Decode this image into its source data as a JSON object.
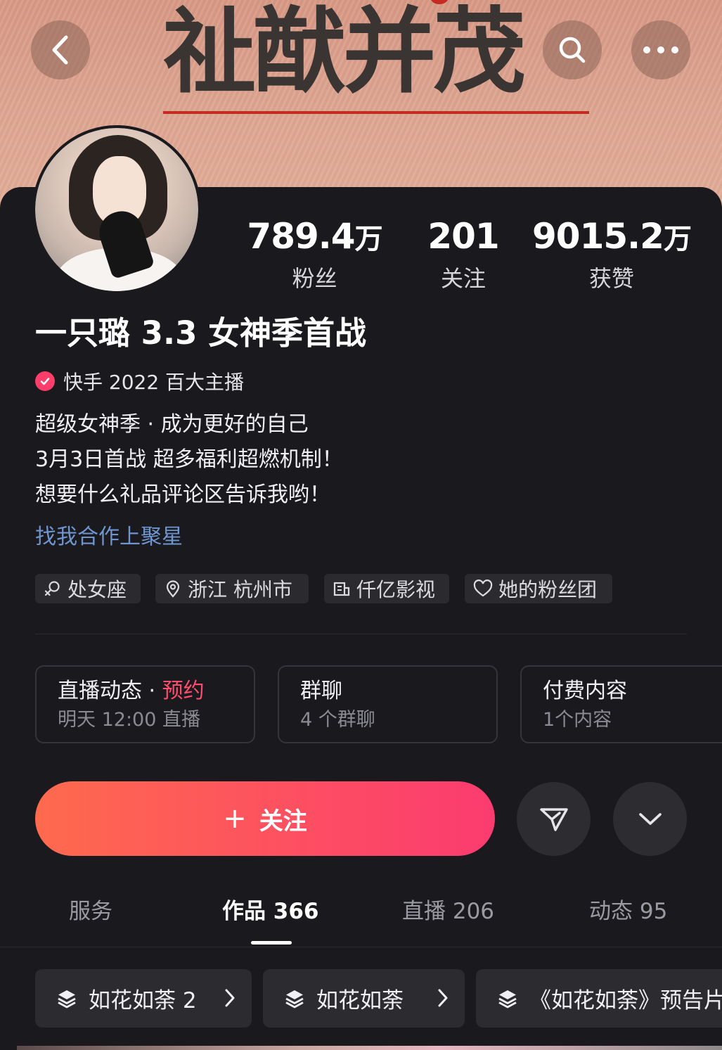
{
  "banner": {
    "title": "祉猷并茂"
  },
  "header": {
    "back": "back",
    "search": "search",
    "more": "more"
  },
  "stats": [
    {
      "value": "789.4",
      "unit": "万",
      "label": "粉丝"
    },
    {
      "value": "201",
      "unit": "",
      "label": "关注"
    },
    {
      "value": "9015.2",
      "unit": "万",
      "label": "获赞"
    }
  ],
  "profile": {
    "name": "一只璐 3.3 女神季首战",
    "verification": "快手 2022 百大主播",
    "bio": [
      "超级女神季 · 成为更好的自己",
      "3月3日首战 超多福利超燃机制！",
      "想要什么礼品评论区告诉我哟！"
    ],
    "link": "找我合作上聚星"
  },
  "tags": [
    {
      "icon": "zodiac-icon",
      "label": "处女座"
    },
    {
      "icon": "location-icon",
      "label": "浙江 杭州市"
    },
    {
      "icon": "company-icon",
      "label": "仟亿影视"
    },
    {
      "icon": "heart-icon",
      "label": "她的粉丝团"
    }
  ],
  "boxes": [
    {
      "title": "直播动态",
      "sep": " · ",
      "highlight": "预约",
      "sub": "明天 12:00 直播"
    },
    {
      "title": "群聊",
      "sub": "4 个群聊"
    },
    {
      "title": "付费内容",
      "sub": "1个内容"
    }
  ],
  "actions": {
    "follow_plus": "+",
    "follow_label": "关注"
  },
  "tabs": [
    {
      "label": "服务"
    },
    {
      "label": "作品 366"
    },
    {
      "label": "直播 206"
    },
    {
      "label": "动态 95"
    }
  ],
  "collections": [
    {
      "label": "如花如荼 2"
    },
    {
      "label": "如花如荼"
    },
    {
      "label": "《如花如荼》预告片"
    }
  ],
  "colors": {
    "accent": "#fd5060",
    "link": "#6f95d1",
    "verify": "#ff3d6b",
    "highlight": "#ff4d6d"
  }
}
